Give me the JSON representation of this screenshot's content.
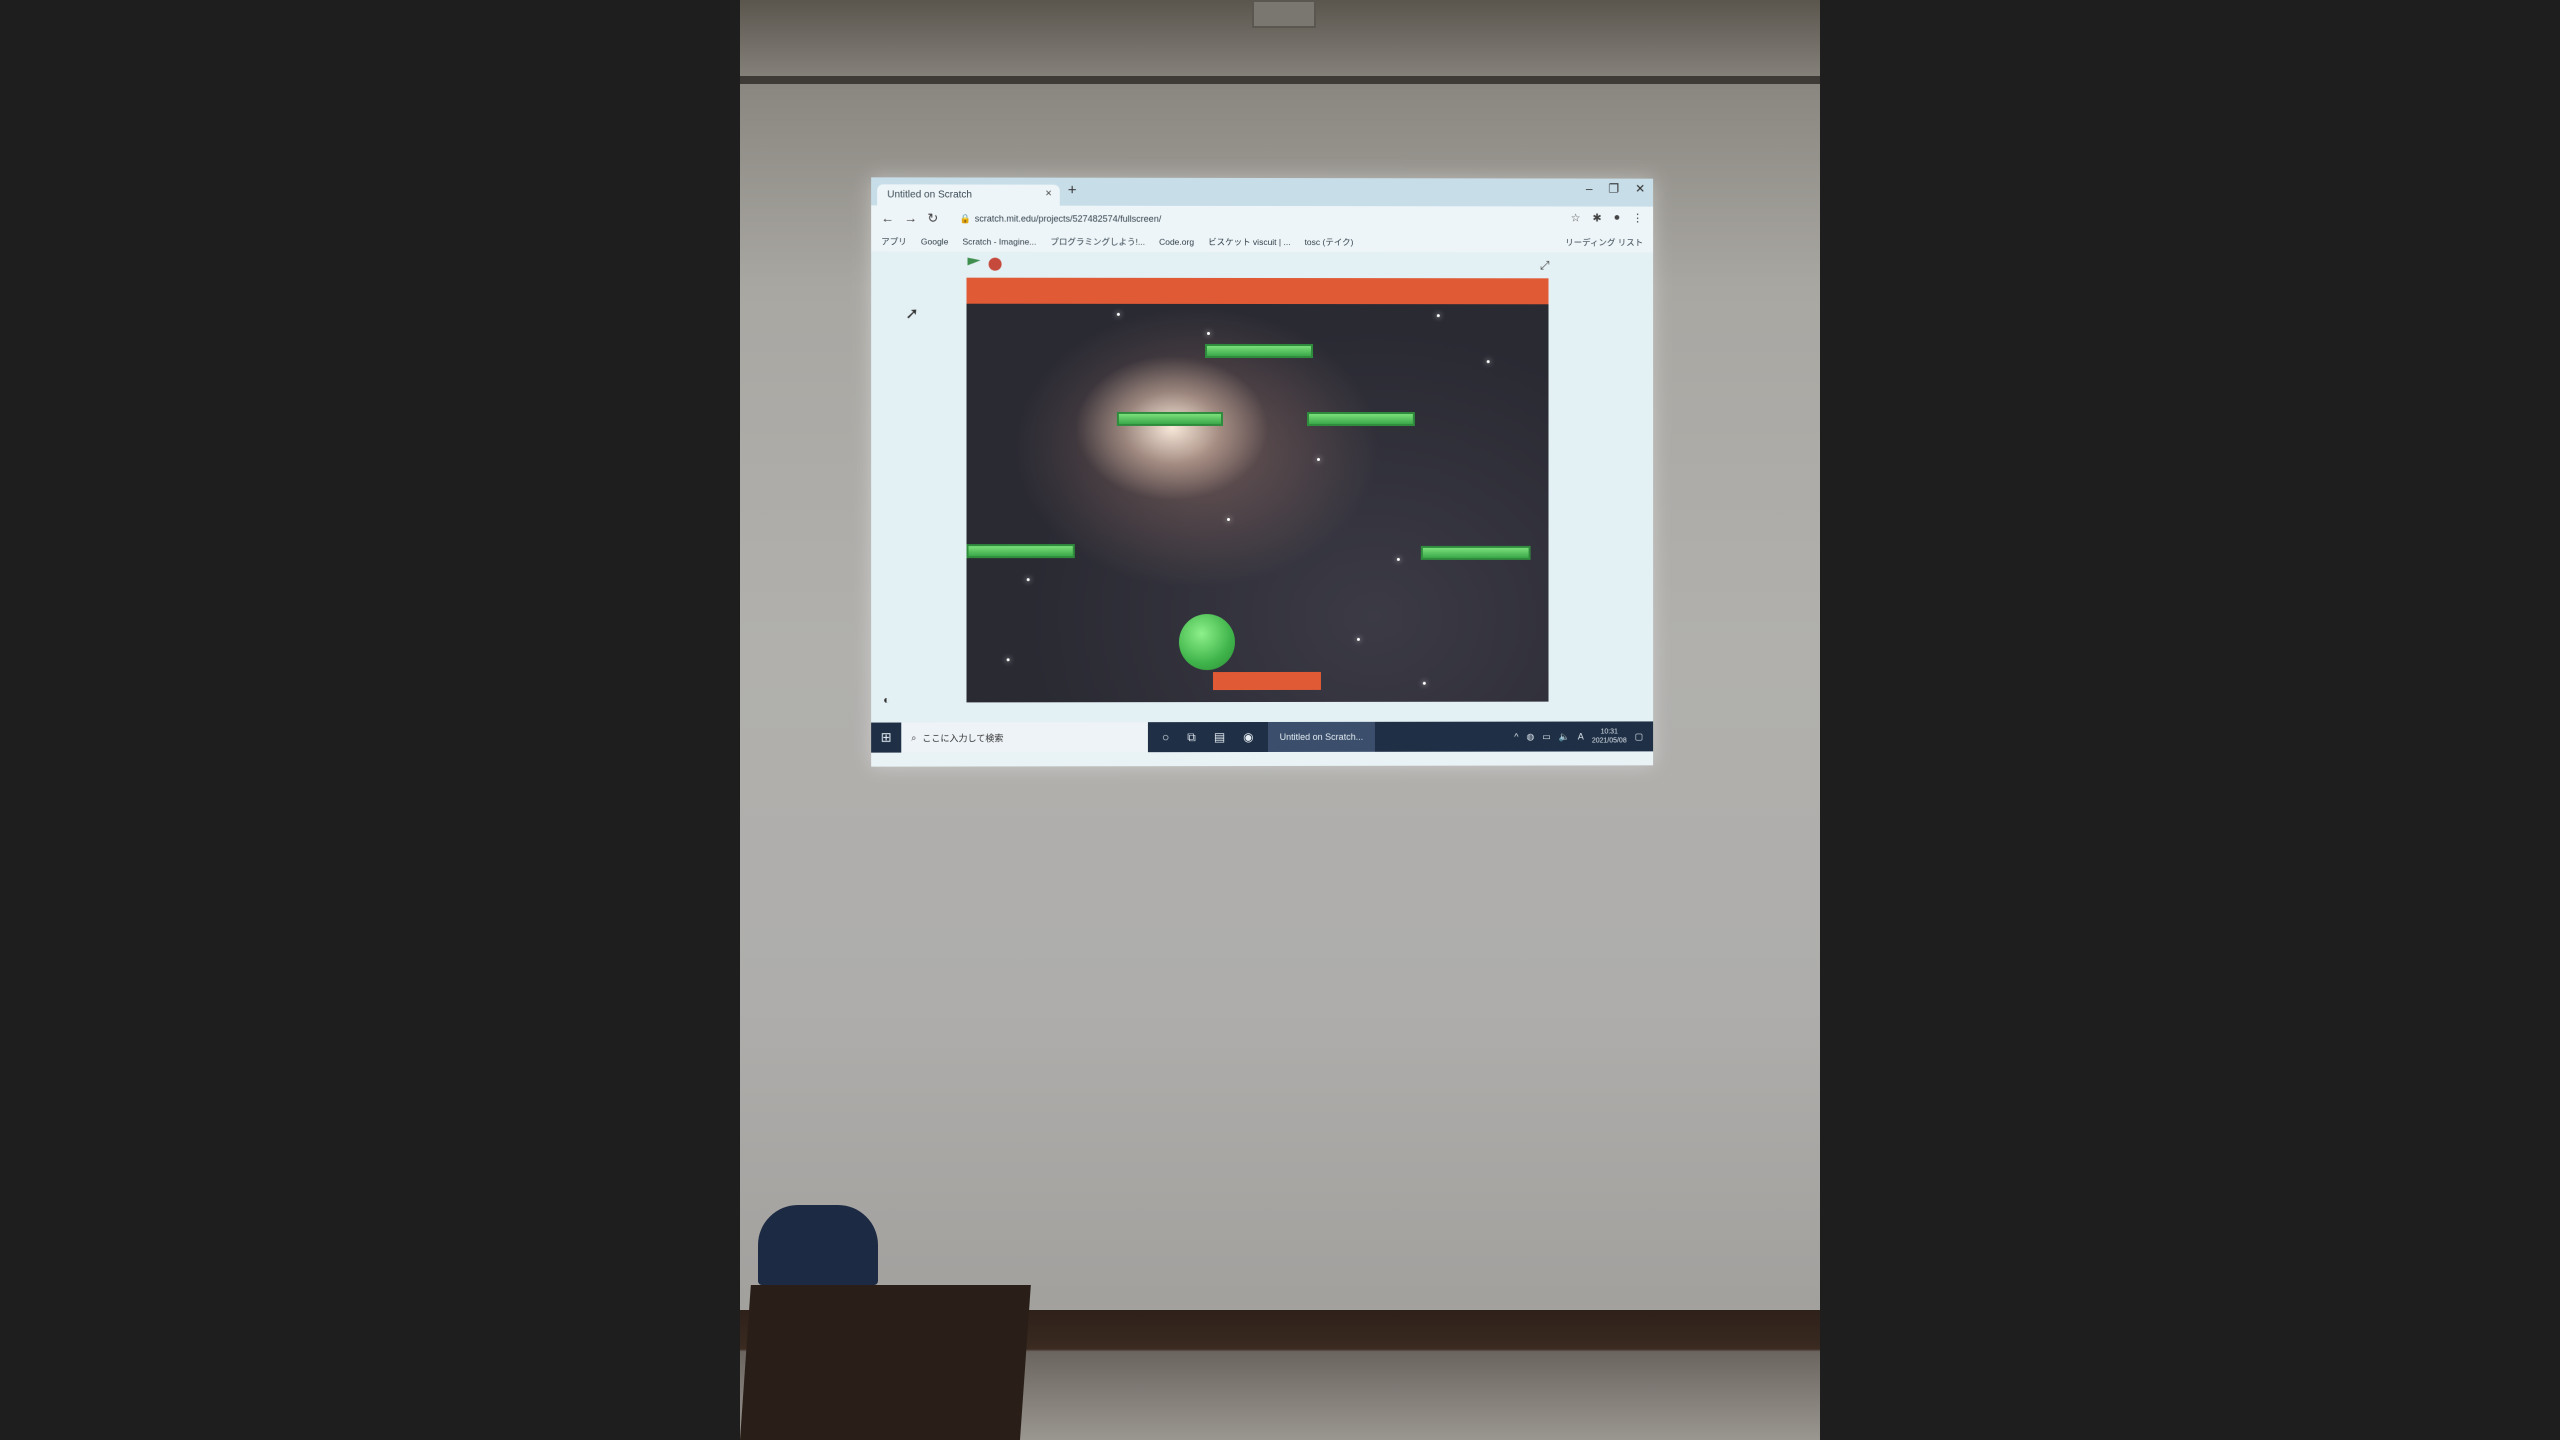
{
  "browser": {
    "tab_title": "Untitled on Scratch",
    "tab_close": "×",
    "new_tab": "+",
    "window_controls": [
      "–",
      "❐",
      "✕"
    ],
    "url": "scratch.mit.edu/projects/527482574/fullscreen/",
    "nav": [
      "←",
      "→",
      "↻"
    ],
    "bookmarks": [
      "アプリ",
      "Google",
      "Scratch - Imagine...",
      "プログラミングしよう!...",
      "Code.org",
      "ビスケット viscuit | ...",
      "tosc (テイク)"
    ],
    "reading_list": "リーディング リスト"
  },
  "scratch": {
    "green_flag_icon": "green-flag-icon",
    "stop_icon": "stop-icon",
    "fullscreen_icon": "fullscreen-icon"
  },
  "taskbar": {
    "search_placeholder": "ここに入力して検索",
    "app_label": "Untitled on Scratch...",
    "time": "10:31",
    "date": "2021/05/08"
  },
  "colors": {
    "top_bar": "#e05a36",
    "paddle": "#e05a36",
    "platform": "#4cc05a",
    "ball": "#4fbf55"
  }
}
